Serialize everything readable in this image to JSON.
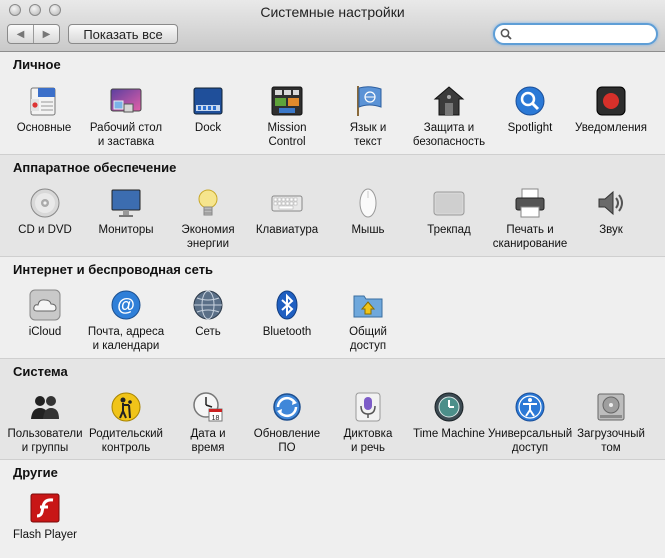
{
  "window": {
    "title": "Системные настройки",
    "nav_back": "◀",
    "nav_forward": "▶",
    "show_all": "Показать все",
    "search": {
      "value": "",
      "placeholder": ""
    }
  },
  "sections": {
    "personal": {
      "title": "Личное",
      "items": [
        {
          "label": "Основные",
          "icon": "general-icon"
        },
        {
          "label": "Рабочий стол\nи заставка",
          "icon": "desktop-screensaver-icon"
        },
        {
          "label": "Dock",
          "icon": "dock-icon"
        },
        {
          "label": "Mission\nControl",
          "icon": "mission-control-icon"
        },
        {
          "label": "Язык и\nтекст",
          "icon": "language-text-icon"
        },
        {
          "label": "Защита и\nбезопасность",
          "icon": "security-icon"
        },
        {
          "label": "Spotlight",
          "icon": "spotlight-icon"
        },
        {
          "label": "Уведомления",
          "icon": "notifications-icon"
        }
      ]
    },
    "hardware": {
      "title": "Аппаратное обеспечение",
      "items": [
        {
          "label": "CD и DVD",
          "icon": "cd-dvd-icon"
        },
        {
          "label": "Мониторы",
          "icon": "displays-icon"
        },
        {
          "label": "Экономия\nэнергии",
          "icon": "energy-saver-icon"
        },
        {
          "label": "Клавиатура",
          "icon": "keyboard-icon"
        },
        {
          "label": "Мышь",
          "icon": "mouse-icon"
        },
        {
          "label": "Трекпад",
          "icon": "trackpad-icon"
        },
        {
          "label": "Печать и\nсканирование",
          "icon": "print-scan-icon"
        },
        {
          "label": "Звук",
          "icon": "sound-icon"
        }
      ]
    },
    "internet": {
      "title": "Интернет и беспроводная сеть",
      "items": [
        {
          "label": "iCloud",
          "icon": "icloud-icon"
        },
        {
          "label": "Почта, адреса\nи календари",
          "icon": "mail-contacts-calendars-icon"
        },
        {
          "label": "Сеть",
          "icon": "network-icon"
        },
        {
          "label": "Bluetooth",
          "icon": "bluetooth-icon"
        },
        {
          "label": "Общий\nдоступ",
          "icon": "sharing-icon"
        }
      ]
    },
    "system": {
      "title": "Система",
      "items": [
        {
          "label": "Пользователи\nи группы",
          "icon": "users-groups-icon"
        },
        {
          "label": "Родительский\nконтроль",
          "icon": "parental-controls-icon"
        },
        {
          "label": "Дата и\nвремя",
          "icon": "date-time-icon"
        },
        {
          "label": "Обновление\nПО",
          "icon": "software-update-icon"
        },
        {
          "label": "Диктовка\nи речь",
          "icon": "dictation-speech-icon"
        },
        {
          "label": "Time Machine",
          "icon": "time-machine-icon"
        },
        {
          "label": "Универсальный\nдоступ",
          "icon": "accessibility-icon"
        },
        {
          "label": "Загрузочный\nтом",
          "icon": "startup-disk-icon"
        }
      ]
    },
    "other": {
      "title": "Другие",
      "items": [
        {
          "label": "Flash Player",
          "icon": "flash-player-icon"
        }
      ]
    }
  },
  "colors": {
    "search_focus": "#5e9ed6",
    "spotlight_blue": "#2b79d6",
    "notification_red": "#d6302a",
    "flash_red": "#c81616",
    "parental_yellow": "#f0c419"
  }
}
